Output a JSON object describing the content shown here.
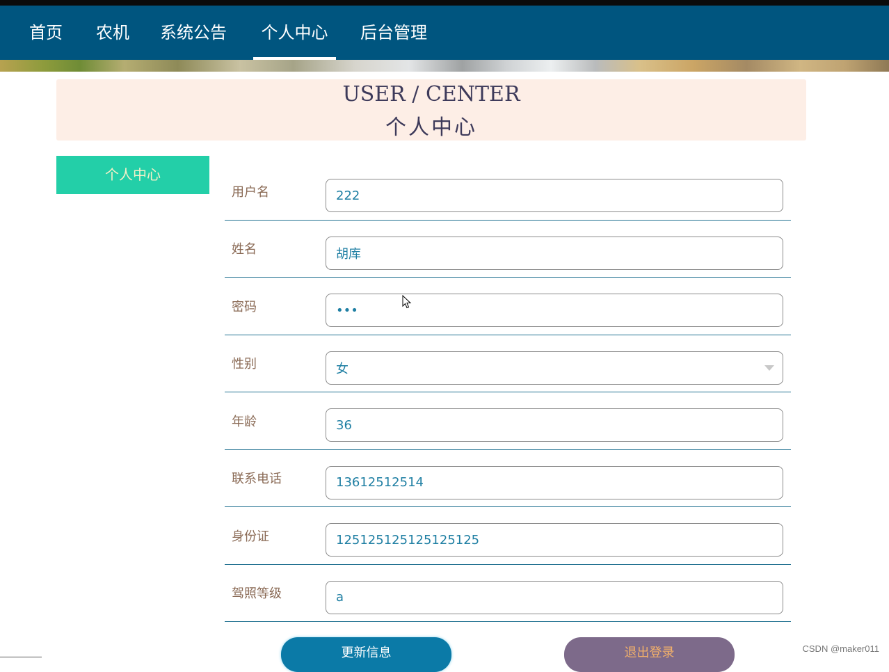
{
  "nav": {
    "items": [
      {
        "label": "首页"
      },
      {
        "label": "农机"
      },
      {
        "label": "系统公告"
      },
      {
        "label": "个人中心",
        "active": true
      },
      {
        "label": "后台管理"
      }
    ]
  },
  "hero": {
    "title_en": "USER / CENTER",
    "title_cn": "个人中心"
  },
  "sidebar": {
    "button_label": "个人中心"
  },
  "form": {
    "username": {
      "label": "用户名",
      "value": "222"
    },
    "name": {
      "label": "姓名",
      "value": "胡库"
    },
    "password": {
      "label": "密码",
      "value": "•••"
    },
    "gender": {
      "label": "性别",
      "value": "女"
    },
    "age": {
      "label": "年龄",
      "value": "36"
    },
    "phone": {
      "label": "联系电话",
      "value": "13612512514"
    },
    "id_card": {
      "label": "身份证",
      "value": "125125125125125125"
    },
    "license": {
      "label": "驾照等级",
      "value": "a"
    }
  },
  "actions": {
    "update_label": "更新信息",
    "logout_label": "退出登录"
  },
  "watermark": "CSDN @maker011",
  "colors": {
    "nav_bg": "#00557f",
    "hero_bg": "#fdeee6",
    "sidebar_btn": "#23cfa8",
    "update_btn": "#0b7aa7",
    "logout_btn": "#7d6a8a",
    "label": "#8a6a55",
    "value": "#1f7fa3"
  }
}
